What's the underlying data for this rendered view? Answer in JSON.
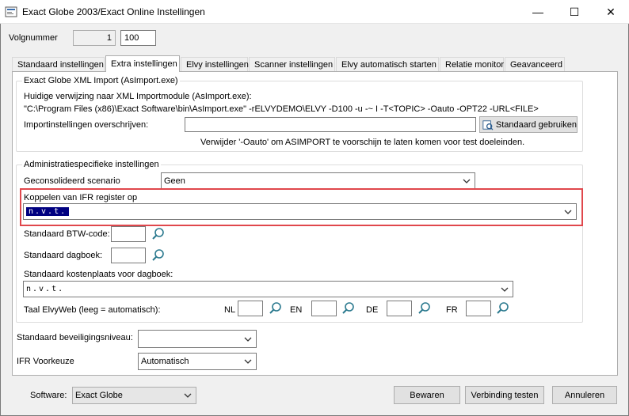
{
  "window": {
    "title": "Exact Globe 2003/Exact Online Instellingen",
    "minimize": "—",
    "maximize": "☐",
    "close": "✕"
  },
  "header": {
    "volgnummer_label": "Volgnummer",
    "volgnummer_value1": "1",
    "volgnummer_value2": "100"
  },
  "tabs": [
    {
      "label": "Standaard instellingen",
      "active": false
    },
    {
      "label": "Extra instellingen",
      "active": true
    },
    {
      "label": "Elvy instellingen",
      "active": false
    },
    {
      "label": "Scanner instellingen",
      "active": false
    },
    {
      "label": "Elvy automatisch starten",
      "active": false
    },
    {
      "label": "Relatie monitor",
      "active": false
    },
    {
      "label": "Geavanceerd",
      "active": false
    }
  ],
  "xml_import": {
    "legend": "Exact Globe XML Import (AsImport.exe)",
    "ref_label": "Huidige verwijzing naar XML Importmodule (AsImport.exe):",
    "ref_path": "\"C:\\Program Files (x86)\\Exact Software\\bin\\AsImport.exe\" -rELVYDEMO\\ELVY -D100 -u -~ I -T<TOPIC> -Oauto -OPT22 -URL<FILE>",
    "override_label": "Importinstellingen overschrijven:",
    "override_value": "",
    "default_button": "Standaard gebruiken",
    "hint": "Verwijder '-Oauto' om ASIMPORT te voorschijn te laten komen voor test doeleinden."
  },
  "admin": {
    "legend": "Administratiespecifieke instellingen",
    "scenario_label": "Geconsolideerd scenario",
    "scenario_value": "Geen",
    "ifr_label": "Koppelen van IFR register op",
    "ifr_value": "n.v.t.",
    "btw_label": "Standaard BTW-code:",
    "dagboek_label": "Standaard dagboek:",
    "kostenplaats_label": "Standaard kostenplaats voor dagboek:",
    "kostenplaats_value": "n.v.t.",
    "taal_label": "Taal ElvyWeb (leeg = automatisch):",
    "lang_nl": "NL",
    "lang_en": "EN",
    "lang_de": "DE",
    "lang_fr": "FR"
  },
  "security": {
    "level_label": "Standaard beveiligingsniveau:",
    "level_value": "",
    "ifr_choice_label": "IFR Voorkeuze",
    "ifr_choice_value": "Automatisch"
  },
  "footer": {
    "software_label": "Software:",
    "software_value": "Exact Globe",
    "save_button": "Bewaren",
    "test_button": "Verbinding testen",
    "cancel_button": "Annuleren"
  }
}
